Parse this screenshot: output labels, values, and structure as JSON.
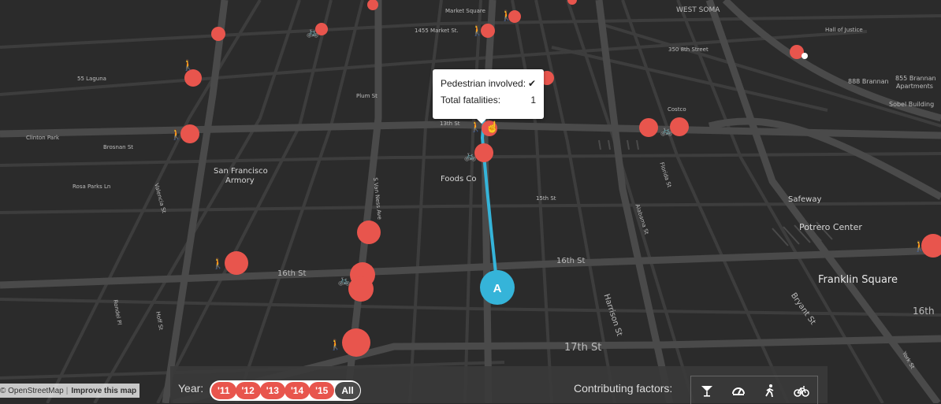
{
  "map": {
    "labels": {
      "west_soma": "WEST SOMA",
      "market_square": "Market Square",
      "market_st": "1455 Market St.",
      "hall_of_justice": "Hall of Justice",
      "brannan_350": "350 8th Street",
      "brannan_888": "888 Brannan",
      "brannan_855": "855 Brannan",
      "apartments": "Apartments",
      "sobel": "Sobel Building",
      "laguna": "55 Laguna",
      "plum_st": "Plum St",
      "clinton_park": "Clinton Park",
      "brosnan_st": "Brosnan St",
      "thirteenth_st": "13th St",
      "sf_armory_1": "San Francisco",
      "sf_armory_2": "Armory",
      "rosa_parks": "Rosa Parks Ln",
      "foods_co": "Foods Co",
      "fifteenth_st": "15th St",
      "costco": "Costco",
      "safeway": "Safeway",
      "potrero_center": "Potrero Center",
      "franklin_square": "Franklin Square",
      "sixteenth_st_left": "16th St",
      "sixteenth_st_right": "16th St",
      "seventeenth_st": "17th St",
      "harrison_st": "Harrison St",
      "bryant_st": "Bryant St",
      "york_st": "York St",
      "alabama_st": "Alabama St",
      "florida_st": "Florida St",
      "s_van_ness": "S Van Ness Ave",
      "valencia_st": "Valencia St",
      "hoff_st": "Hoff St",
      "rondel_pl": "Rondel Pl",
      "sixteenth_far": "16th"
    },
    "route_marker": "A"
  },
  "tooltip": {
    "pedestrian_label": "Pedestrian involved:",
    "pedestrian_value": "✔",
    "fatalities_label": "Total fatalities:",
    "fatalities_value": "1"
  },
  "attribution": {
    "copyright": "© OpenStreetMap",
    "separator": "|",
    "improve": "Improve this map"
  },
  "controls": {
    "year_label": "Year:",
    "years": [
      "'11",
      "'12",
      "'13",
      "'14",
      "'15"
    ],
    "all_label": "All",
    "factors_label": "Contributing factors:",
    "factors": [
      "cocktail-icon",
      "speedometer-icon",
      "pedestrian-icon",
      "bicycle-icon"
    ]
  },
  "colors": {
    "incident": "#e8554d",
    "route": "#35b4d9",
    "background": "#2b2b2b"
  }
}
